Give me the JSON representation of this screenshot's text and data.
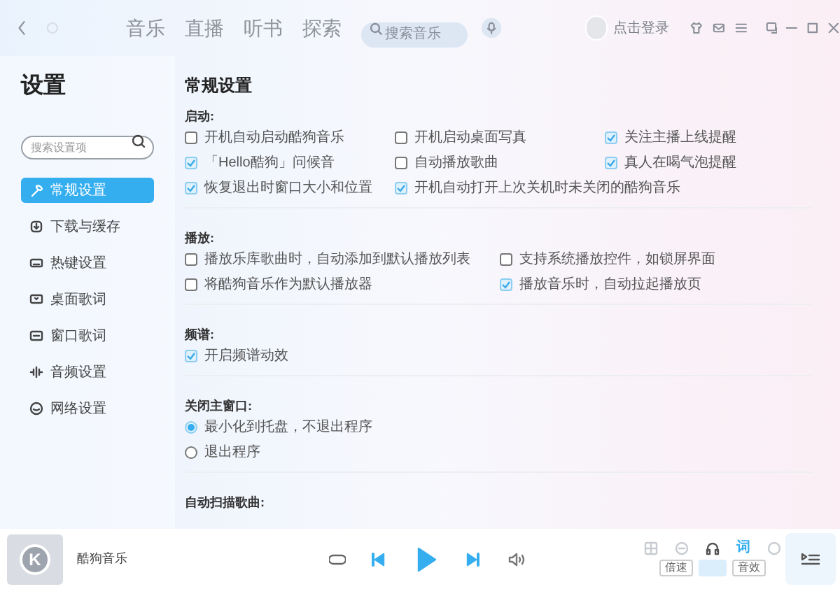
{
  "top_bar": {
    "nav_tabs": [
      {
        "label": "音乐",
        "selected": false
      },
      {
        "label": "直播",
        "selected": false
      },
      {
        "label": "听书",
        "selected": false
      },
      {
        "label": "探索",
        "selected": false
      }
    ],
    "search": {
      "placeholder": "搜索音乐"
    },
    "login": "点击登录"
  },
  "sidebar": {
    "title": "设置",
    "search": {
      "placeholder": "搜索设置项"
    },
    "items": [
      {
        "label": "常规设置",
        "selected": true
      },
      {
        "label": "下载与缓存",
        "selected": false
      },
      {
        "label": "热键设置",
        "selected": false
      },
      {
        "label": "桌面歌词",
        "selected": false
      },
      {
        "label": "窗口歌词",
        "selected": false
      },
      {
        "label": "音频设置",
        "selected": false
      },
      {
        "label": "网络设置",
        "selected": false
      }
    ]
  },
  "main": {
    "title": "常规设置",
    "sections": [
      {
        "heading": "启动:",
        "options": [
          {
            "kind": "checkbox",
            "label": "开机自动启动酷狗音乐",
            "checked": false
          },
          {
            "kind": "checkbox",
            "label": "开机启动桌面写真",
            "checked": false
          },
          {
            "kind": "checkbox",
            "label": "关注主播上线提醒",
            "checked": true
          },
          {
            "kind": "checkbox",
            "label": "「Hello酷狗」问候音",
            "checked": true
          },
          {
            "kind": "checkbox",
            "label": "自动播放歌曲",
            "checked": false
          },
          {
            "kind": "checkbox",
            "label": "真人在喝气泡提醒",
            "checked": true
          },
          {
            "kind": "checkbox",
            "label": "恢复退出时窗口大小和位置",
            "checked": true
          },
          {
            "kind": "checkbox",
            "label": "开机自动打开上次关机时未关闭的酷狗音乐",
            "checked": true
          }
        ]
      },
      {
        "heading": "播放:",
        "options": [
          {
            "kind": "checkbox",
            "label": "播放乐库歌曲时，自动添加到默认播放列表",
            "checked": false
          },
          {
            "kind": "checkbox",
            "label": "支持系统播放控件，如锁屏界面",
            "checked": false
          },
          {
            "kind": "checkbox",
            "label": "将酷狗音乐作为默认播放器",
            "checked": false
          },
          {
            "kind": "checkbox",
            "label": "播放音乐时，自动拉起播放页",
            "checked": true
          }
        ]
      },
      {
        "heading": "频谱:",
        "options": [
          {
            "kind": "checkbox",
            "label": "开启频谱动效",
            "checked": true
          }
        ]
      },
      {
        "heading": "关闭主窗口:",
        "options": [
          {
            "kind": "radio",
            "label": "最小化到托盘，不退出程序",
            "selected": true
          },
          {
            "kind": "radio",
            "label": "退出程序",
            "selected": false
          }
        ]
      },
      {
        "heading": "自动扫描歌曲:"
      }
    ]
  },
  "player": {
    "cover_letter": "K",
    "track": "酷狗音乐",
    "lyrics_button": "词",
    "chips": [
      {
        "label": "倍速",
        "selected": false
      },
      {
        "label": "音效",
        "selected": false
      }
    ]
  }
}
